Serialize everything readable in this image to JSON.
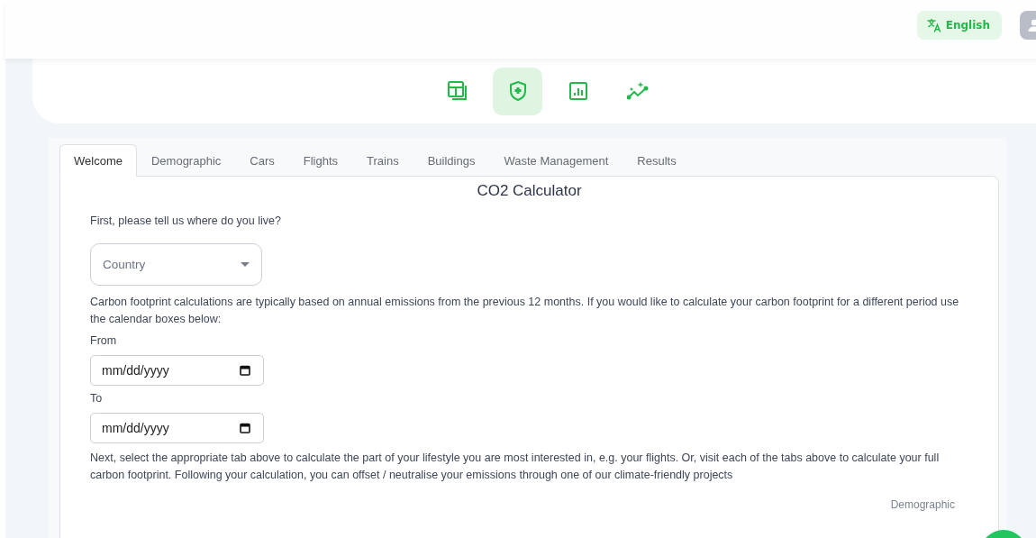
{
  "header": {
    "language_button": "English"
  },
  "nav_icons": [
    {
      "kind": "layout",
      "selected": false
    },
    {
      "kind": "shield",
      "selected": true
    },
    {
      "kind": "chart",
      "selected": false
    },
    {
      "kind": "trend",
      "selected": false
    }
  ],
  "tabs": [
    {
      "label": "Welcome",
      "selected": true
    },
    {
      "label": "Demographic",
      "selected": false
    },
    {
      "label": "Cars",
      "selected": false
    },
    {
      "label": "Flights",
      "selected": false
    },
    {
      "label": "Trains",
      "selected": false
    },
    {
      "label": "Buildings",
      "selected": false
    },
    {
      "label": "Waste Management",
      "selected": false
    },
    {
      "label": "Results",
      "selected": false
    }
  ],
  "content": {
    "title": "CO2 Calculator",
    "question": "First, please tell us where do you live?",
    "country_field": {
      "placeholder": "Country"
    },
    "period_text": "Carbon footprint calculations are typically based on annual emissions from the previous 12 months. If you would like to calculate your carbon footprint for a different period use the calendar boxes below:",
    "from_label": "From",
    "from_field": {
      "placeholder": "mm/dd/yyyy"
    },
    "to_label": "To",
    "to_field": {
      "placeholder": "mm/dd/yyyy"
    },
    "next_text": "Next, select the appropriate tab above to calculate the part of your lifestyle you are most interested in, e.g. your flights. Or, visit each of the tabs above to calculate your full carbon footprint. Following your calculation, you can offset / neutralise your emissions through one of our climate-friendly projects",
    "next_link": "Demographic"
  }
}
